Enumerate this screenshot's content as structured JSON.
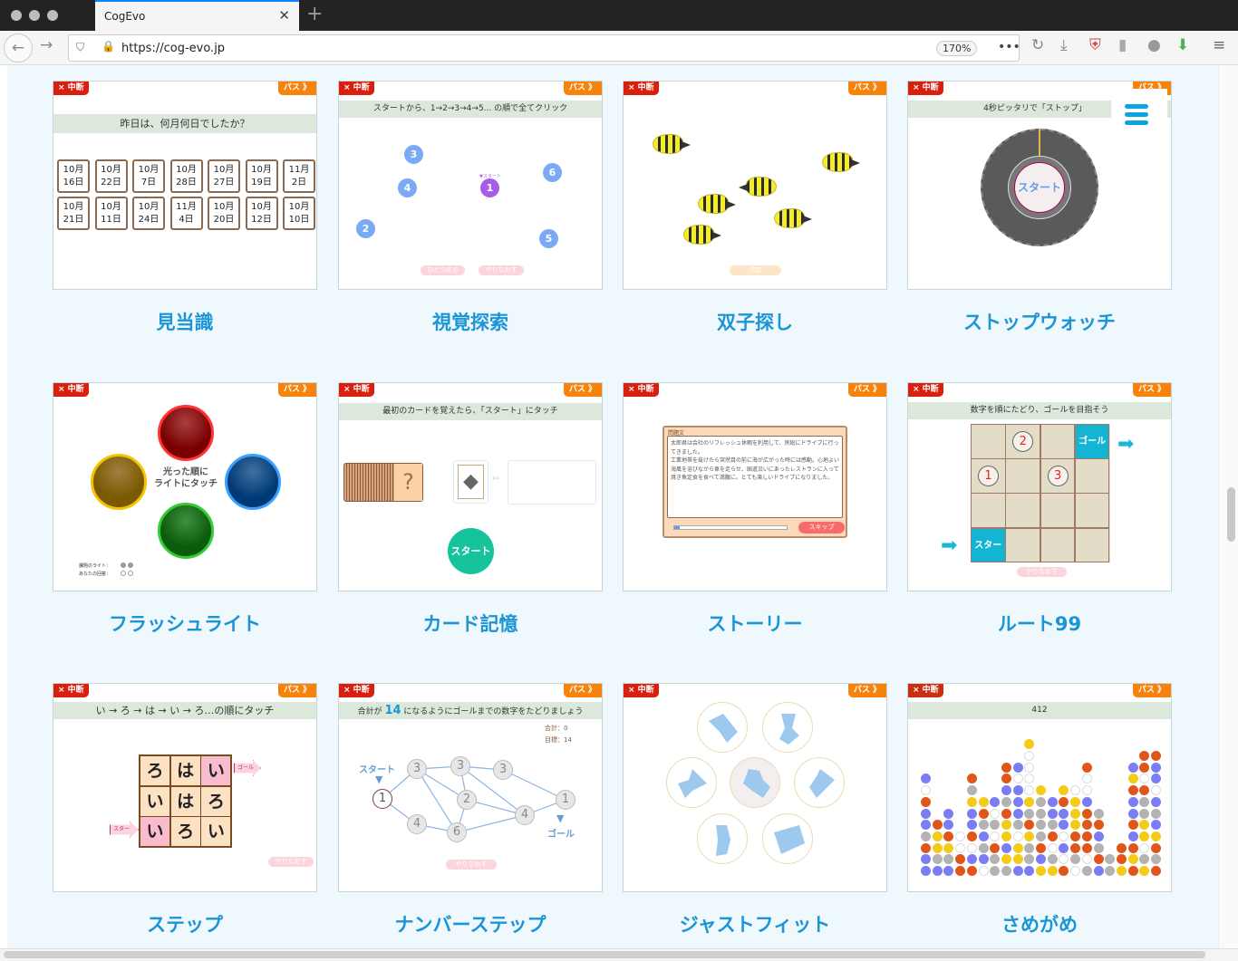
{
  "browser": {
    "tab_title": "CogEvo",
    "url": "https://cog-evo.jp",
    "zoom": "170%"
  },
  "common": {
    "quit": "× 中断",
    "pass": "パス 》",
    "redo": "やりなおす"
  },
  "games": [
    {
      "title": "見当識",
      "instruction": "昨日は、何月何日でしたか？",
      "dates": [
        "10月\n16日",
        "10月\n22日",
        "10月\n7日",
        "10月\n28日",
        "10月\n27日",
        "10月\n19日",
        "11月\n2日",
        "10月\n21日",
        "10月\n11日",
        "10月\n24日",
        "11月\n4日",
        "10月\n20日",
        "10月\n12日",
        "10月\n10日"
      ]
    },
    {
      "title": "視覚探索",
      "instruction": "スタートから、1→2→3→4→5... の順で全てクリック",
      "start_marker": "▼スタート",
      "numbers": [
        "3",
        "4",
        "1",
        "6",
        "2",
        "5"
      ],
      "undo": "ひとつ戻る"
    },
    {
      "title": "双子探し",
      "decide": "決定"
    },
    {
      "title": "ストップウォッチ",
      "instruction": "4秒ピッタリで「ストップ」",
      "start": "スタート"
    },
    {
      "title": "フラッシュライト",
      "center": "光った順に\nライトにタッチ",
      "task_label": "課題のライト：",
      "answer_label": "あなたの回答："
    },
    {
      "title": "カード記憶",
      "instruction": "最初のカードを覚えたら、「スタート」にタッチ",
      "question": "?",
      "start": "スタート"
    },
    {
      "title": "ストーリー",
      "panel_label": "問題文",
      "text": "太郎君は会社のリフレッシュ休暇を利用して、房総にドライブに行ってきました。\n工業地帯を抜けたら突然目の前に海が広がった時には感動。心地よい海風を浴びながら車を走らせ、国道沿いにあったレストランに入って焼き魚定食を食べて満腹に。とても楽しいドライブになりました。",
      "skip": "スキップ",
      "progress": 0.05
    },
    {
      "title": "ルート99",
      "instruction": "数字を順にたどり、ゴールを目指そう",
      "goal": "ゴール",
      "start": "スタート",
      "nums": [
        "2",
        "1",
        "3"
      ]
    },
    {
      "title": "ステップ",
      "instruction": "い → ろ → は → い → ろ…の順にタッチ",
      "grid": [
        "ろ",
        "は",
        "い",
        "い",
        "は",
        "ろ",
        "い",
        "ろ",
        "い"
      ],
      "goal": "ゴール",
      "start": "スタート"
    },
    {
      "title": "ナンバーステップ",
      "instruction_pre": "合計が",
      "target": "14",
      "instruction_post": "になるようにゴールまでの数字をたどりましょう",
      "sum": "合計：0",
      "goal_value": "目標：14",
      "start": "スタート",
      "goal": "ゴール",
      "nodes": [
        "1",
        "3",
        "4",
        "3",
        "2",
        "6",
        "3",
        "4",
        "1"
      ]
    },
    {
      "title": "ジャストフィット"
    },
    {
      "title": "さめがめ",
      "score": "412"
    }
  ],
  "colors": {
    "title": "#1b95d6",
    "quit": "#d8200f",
    "pass": "#f7830d",
    "bar": "#dce8dc"
  }
}
